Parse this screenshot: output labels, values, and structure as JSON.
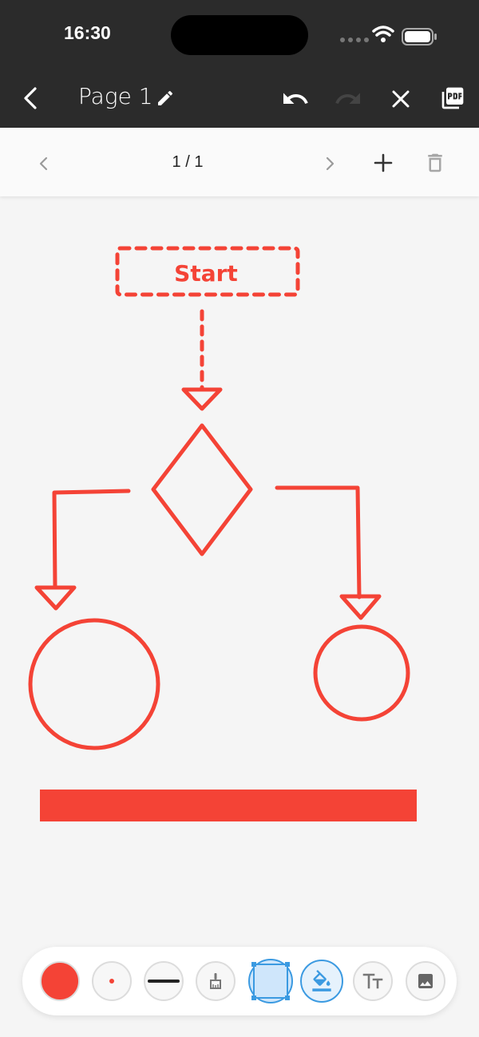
{
  "status": {
    "time": "16:30"
  },
  "header": {
    "title": "Page 1"
  },
  "pager": {
    "label": "1 / 1"
  },
  "canvas": {
    "start_label": "Start"
  },
  "colors": {
    "accent": "#f44336",
    "selected": "#3b9ae1",
    "header_bg": "#2b2b2b"
  },
  "icons": {
    "header": [
      "back-icon",
      "edit-icon",
      "undo-icon",
      "redo-icon",
      "close-icon",
      "pdf-icon"
    ],
    "nav": [
      "prev-page-icon",
      "next-page-icon",
      "add-page-icon",
      "trash-icon"
    ],
    "tools": [
      "color-tool",
      "dot-size-tool",
      "line-width-tool",
      "brush-icon",
      "shape-tool",
      "fill-tool",
      "text-tool",
      "image-tool"
    ]
  }
}
